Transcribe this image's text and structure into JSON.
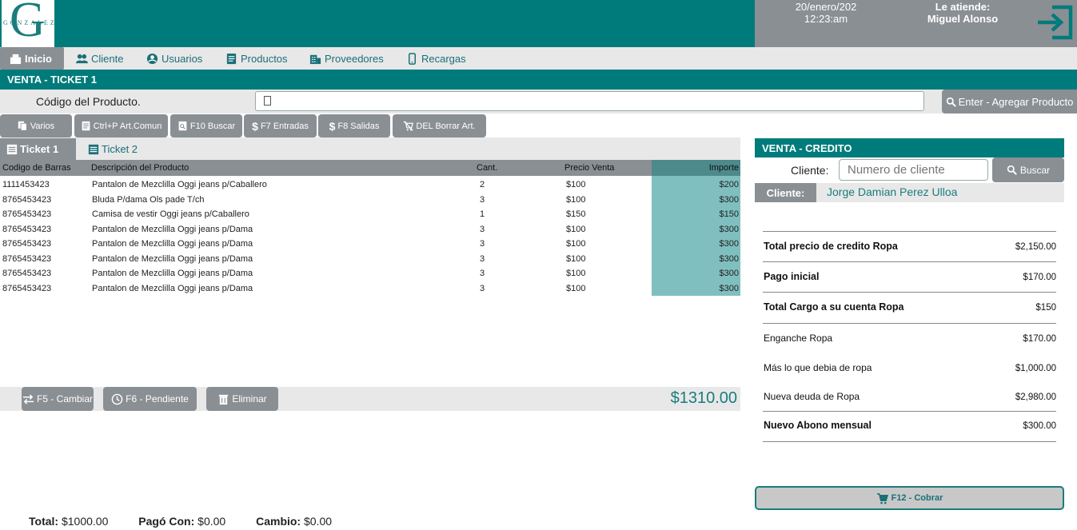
{
  "header": {
    "logo_letter": "G",
    "logo_text": "GONZALEZ",
    "date": "20/enero/202",
    "time": "12:23:am",
    "attend_label": "Le atiende:",
    "attend_name": "Miguel Alonso"
  },
  "nav": {
    "tabs": [
      {
        "label": "Inicio",
        "icon": "cash-register-icon"
      },
      {
        "label": "Cliente",
        "icon": "users-icon"
      },
      {
        "label": "Usuarios",
        "icon": "globe-user-icon"
      },
      {
        "label": "Productos",
        "icon": "document-icon"
      },
      {
        "label": "Proveedores",
        "icon": "building-icon"
      },
      {
        "label": "Recargas",
        "icon": "phone-icon"
      }
    ]
  },
  "sale": {
    "title": "VENTA - TICKET 1",
    "code_label": "Código del Producto.",
    "code_value": "",
    "add_button": "Enter - Agregar Producto"
  },
  "toolbar": {
    "varios": "Varios",
    "art_comun": "Ctrl+P Art.Comun",
    "buscar": "F10 Buscar",
    "entradas": "F7 Entradas",
    "salidas": "F8 Salidas",
    "borrar": "DEL Borrar Art."
  },
  "tickets": {
    "tabs": [
      "Ticket 1",
      "Ticket 2"
    ]
  },
  "table": {
    "headers": [
      "Codigo de Barras",
      "Descripción del Producto",
      "Cant.",
      "Precio Venta",
      "Importe"
    ],
    "rows": [
      [
        "1111453423",
        "Pantalon de Mezclilla Oggi jeans p/Caballero",
        "2",
        "$100",
        "$200"
      ],
      [
        "8765453423",
        "Bluda P/dama Ols pade T/ch",
        "3",
        "$100",
        "$300"
      ],
      [
        "8765453423",
        "Camisa de vestir Oggi jeans p/Caballero",
        "1",
        "$150",
        "$150"
      ],
      [
        "8765453423",
        "Pantalon de Mezclilla Oggi jeans p/Dama",
        "3",
        "$100",
        "$300"
      ],
      [
        "8765453423",
        "Pantalon de Mezclilla Oggi jeans p/Dama",
        "3",
        "$100",
        "$300"
      ],
      [
        "8765453423",
        "Pantalon de Mezclilla Oggi jeans p/Dama",
        "3",
        "$100",
        "$300"
      ],
      [
        "8765453423",
        "Pantalon de Mezclilla Oggi jeans p/Dama",
        "3",
        "$100",
        "$300"
      ],
      [
        "8765453423",
        "Pantalon de Mezclilla Oggi jeans p/Dama",
        "3",
        "$100",
        "$300"
      ]
    ]
  },
  "bottom": {
    "cambiar": "F5 - Cambiar",
    "pendiente": "F6 - Pendiente",
    "eliminar": "Eliminar",
    "grand_total": "$1310.00"
  },
  "footer": {
    "total_label": "Total:",
    "total_value": "$1000.00",
    "pago_label": "Pagó Con:",
    "pago_value": "$0.00",
    "cambio_label": "Cambio:",
    "cambio_value": "$0.00"
  },
  "credit": {
    "title": "VENTA - CREDITO",
    "client_label": "Cliente:",
    "client_placeholder": "Numero de cliente",
    "search_button": "Buscar",
    "client_tag": "Cliente:",
    "client_name": "Jorge Damian Perez Ulloa",
    "lines": [
      {
        "label": "Total precio de credito Ropa",
        "value": "$2,150.00",
        "bold": true
      },
      {
        "label": "Pago inicial",
        "value": "$170.00",
        "bold": true
      },
      {
        "label": "Total Cargo a su cuenta Ropa",
        "value": "$150",
        "bold": true
      },
      {
        "label": "Enganche Ropa",
        "value": "$170.00",
        "bold": false
      },
      {
        "label": "Más lo que debia de ropa",
        "value": "$1,000.00",
        "bold": false
      },
      {
        "label": "Nueva deuda de Ropa",
        "value": "$2,980.00",
        "bold": false
      },
      {
        "label": "Nuevo Abono mensual",
        "value": "$300.00",
        "bold": true
      }
    ],
    "cobrar_button": "F12 - Cobrar"
  },
  "colors": {
    "teal": "#007b7b",
    "importe_bg": "#80bfbf",
    "gray_button": "#8a8f94",
    "light_bar": "#e8e8e8"
  }
}
